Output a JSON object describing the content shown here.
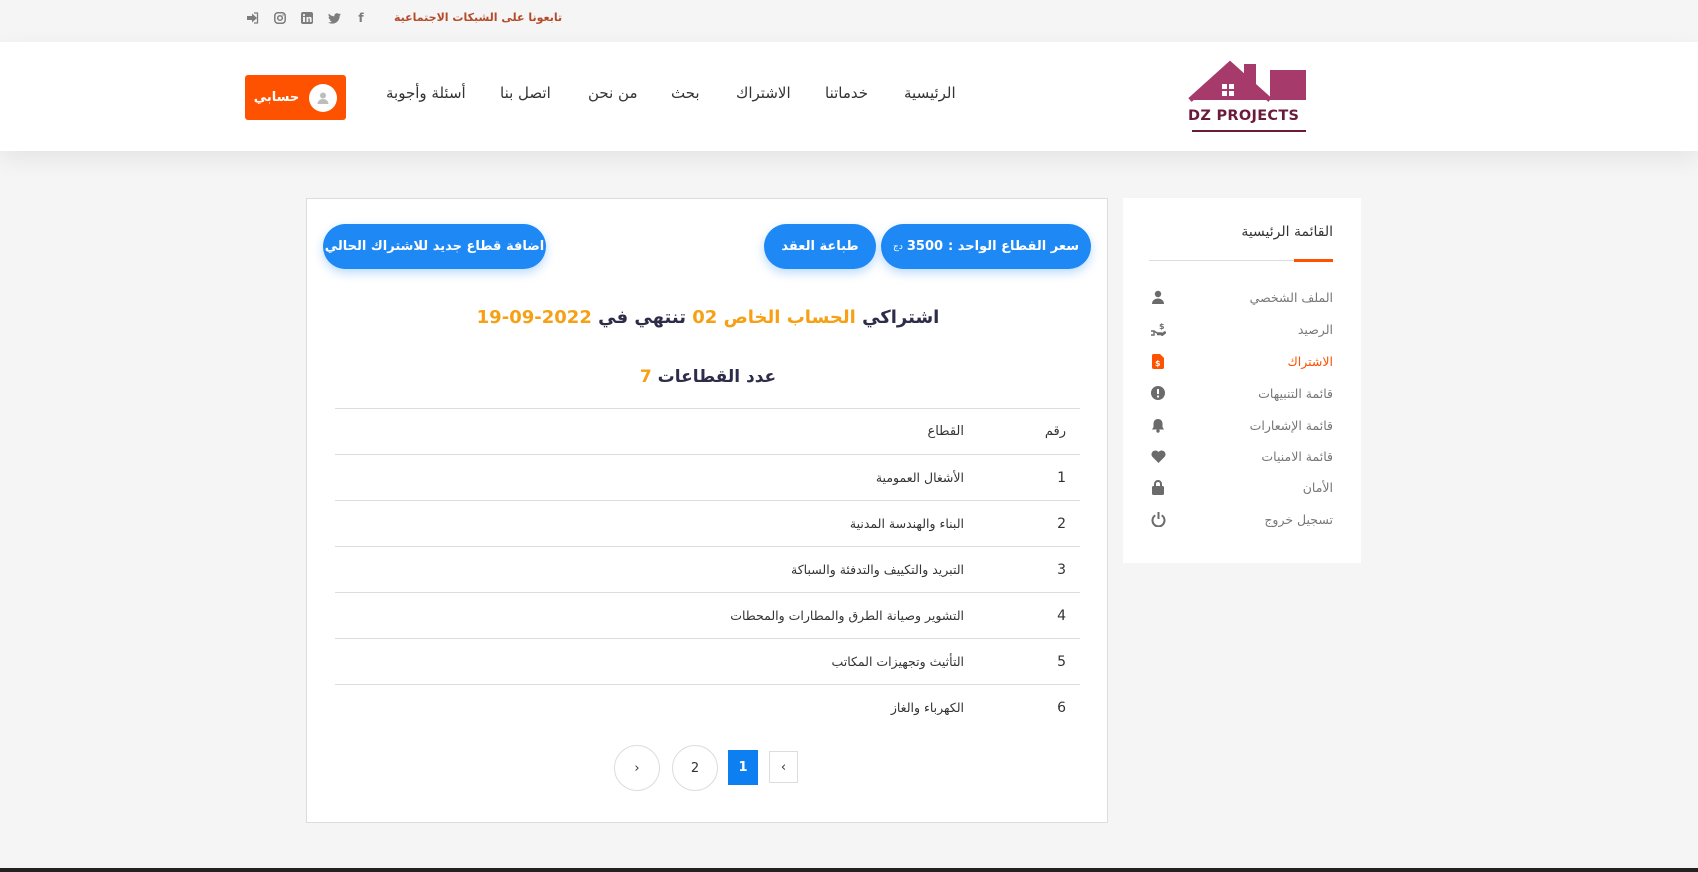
{
  "topbar": {
    "follow_text": "تابعونا على الشبكات الاجتماعية",
    "social_icons": [
      "facebook-icon",
      "twitter-icon",
      "linkedin-icon",
      "instagram-icon",
      "sign-in-icon"
    ]
  },
  "header": {
    "logo_text": "DZ PROJECTS",
    "nav": [
      "الرئيسية",
      "خدماتنا",
      "الاشتراك",
      "بحث",
      "من نحن",
      "اتصل بنا",
      "أسئلة وأجوبة"
    ],
    "account_label": "حسابي"
  },
  "sidebar": {
    "title": "القائمة الرئيسية",
    "items": [
      {
        "label": "الملف الشخصي",
        "icon": "user-icon"
      },
      {
        "label": "الرصيد",
        "icon": "hand-money-icon"
      },
      {
        "label": "الاشتراك",
        "icon": "invoice-icon",
        "active": true
      },
      {
        "label": "قائمة التنبيهات",
        "icon": "alert-icon"
      },
      {
        "label": "قائمة الإشعارات",
        "icon": "bell-icon"
      },
      {
        "label": "قائمة الامنيات",
        "icon": "heart-icon"
      },
      {
        "label": "الأمان",
        "icon": "lock-icon"
      },
      {
        "label": "تسجيل خروج",
        "icon": "power-icon"
      }
    ]
  },
  "main": {
    "price_label": "سعر القطاع الواحد :",
    "price_value": "3500",
    "price_unit": "دج",
    "print_label": "طباعة العقد",
    "add_sector_label": "اضافة قطاع جديد للاشتراك الحالي",
    "headline": {
      "part1": "اشتراكي",
      "account": "الحساب الخاص",
      "num": "02",
      "part2": "تنتهي في",
      "date": "2022-09-19"
    },
    "sectors_count_label": "عدد القطاعات",
    "sectors_count": "7",
    "table": {
      "headers": {
        "num": "رقم",
        "sector": "القطاع"
      },
      "rows": [
        {
          "num": "1",
          "sector": "الأشغال العمومية"
        },
        {
          "num": "2",
          "sector": "البناء والهندسة المدنية"
        },
        {
          "num": "3",
          "sector": "التبريد والتكييف والتدفئة والسباكة"
        },
        {
          "num": "4",
          "sector": "التشوير وصيانة الطرق والمطارات والمحطات"
        },
        {
          "num": "5",
          "sector": "التأثيث وتجهيزات المكاتب"
        },
        {
          "num": "6",
          "sector": "الكهرباء والغاز"
        }
      ]
    },
    "pagination": {
      "prev": "‹",
      "pages": [
        "1",
        "2"
      ],
      "current": "1",
      "next": "›"
    }
  },
  "colors": {
    "accent": "#ff5200",
    "primary": "#1e88f5",
    "highlight": "#f5a015",
    "logo": "#a63a6a"
  }
}
